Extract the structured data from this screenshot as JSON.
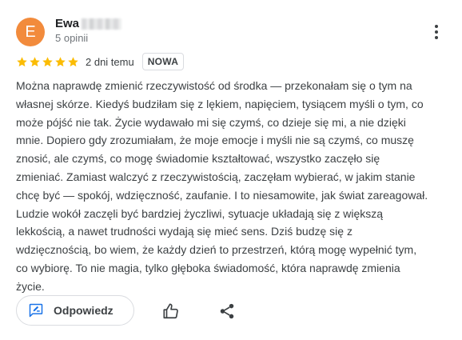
{
  "reviewer": {
    "initial": "E",
    "name": "Ewa",
    "review_count": "5 opinii",
    "avatar_color": "#f28b3c"
  },
  "review": {
    "rating": 5,
    "star_color": "#fbbc04",
    "date": "2 dni temu",
    "badge": "NOWA",
    "text": "Można naprawdę zmienić rzeczywistość od środka — przekonałam się o tym na własnej skórze. Kiedyś budziłam się z lękiem, napięciem, tysiącem myśli o tym, co może pójść nie tak. Życie wydawało mi się czymś, co dzieje się mi, a nie dzięki mnie. Dopiero gdy zrozumiałam, że moje emocje i myśli nie są czymś, co muszę znosić, ale czymś, co mogę świadomie kształtować, wszystko zaczęło się zmieniać. Zamiast walczyć z rzeczywistością, zaczęłam wybierać, w jakim stanie chcę być — spokój, wdzięczność, zaufanie. I to niesamowite, jak świat zareagował. Ludzie wokół zaczęli być bardziej życzliwi, sytuacje układają się z większą lekkością, a nawet trudności wydają się mieć sens. Dziś budzę się z wdzięcznością, bo wiem, że każdy dzień to przestrzeń, którą mogę wypełnić tym, co wybiorę. To nie magia, tylko głęboka świadomość, która naprawdę zmienia życie."
  },
  "actions": {
    "reply_label": "Odpowiedz",
    "reply_icon_color": "#1a73e8",
    "reply_icon": "reply-edit-icon",
    "like_icon": "thumbs-up-icon",
    "share_icon": "share-icon",
    "more_icon": "more-vert-icon"
  }
}
